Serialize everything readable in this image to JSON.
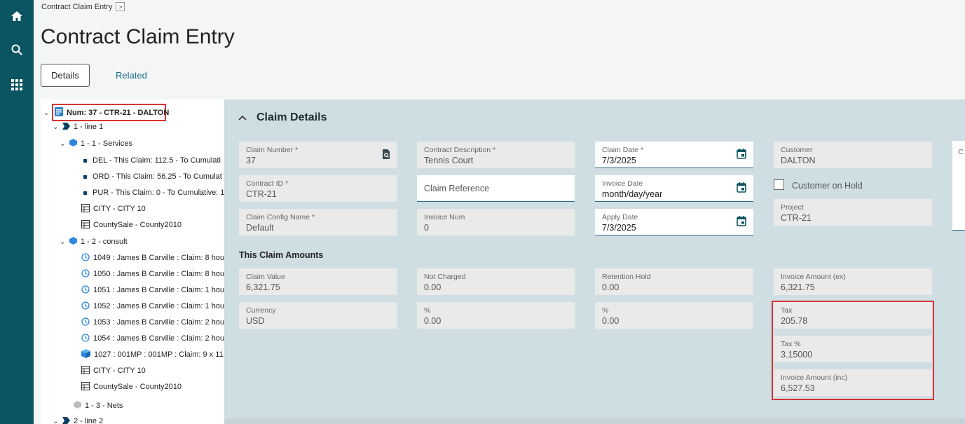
{
  "rail": {
    "icons": [
      "home-icon",
      "search-icon",
      "apps-grid-icon"
    ]
  },
  "breadcrumb": {
    "label": "Contract Claim Entry",
    "more": ">"
  },
  "page_title": "Contract Claim Entry",
  "tabs": [
    {
      "label": "Details"
    },
    {
      "label": "Related"
    }
  ],
  "tree": {
    "root": "Num: 37 - CTR-21 - DALTON",
    "nodes": [
      {
        "label": "1 - line 1"
      },
      {
        "label": "1 - 1 - Services"
      },
      {
        "label": "DEL - This Claim: 112.5 - To Cumulati"
      },
      {
        "label": "ORD - This Claim: 56.25 - To Cumulat"
      },
      {
        "label": "PUR - This Claim: 0 - To Cumulative: 1"
      },
      {
        "label": "CITY - CITY 10"
      },
      {
        "label": "CountySale - County2010"
      },
      {
        "label": "1 - 2 - consult"
      },
      {
        "label": "1049 : James B Carville : Claim: 8 hou"
      },
      {
        "label": "1050 : James B Carville : Claim: 8 hou"
      },
      {
        "label": "1051 : James B Carville : Claim: 1 hou"
      },
      {
        "label": "1052 : James B Carville : Claim: 1 hou"
      },
      {
        "label": "1053 : James B Carville : Claim: 2 hou"
      },
      {
        "label": "1054 : James B Carville : Claim: 2 hou"
      },
      {
        "label": "1027 : 001MP : 001MP : Claim: 9 x 11 U"
      },
      {
        "label": "CITY - CITY 10"
      },
      {
        "label": "CountySale - County2010"
      },
      {
        "label": "1 - 3 - Nets"
      },
      {
        "label": "2 - line 2"
      }
    ]
  },
  "claim_details": {
    "title": "Claim Details",
    "claim_number": {
      "label": "Claim Number *",
      "value": "37"
    },
    "contract_description": {
      "label": "Contract Description *",
      "value": "Tennis Court"
    },
    "claim_date": {
      "label": "Claim Date *",
      "value": "7/3/2025"
    },
    "customer": {
      "label": "Customer",
      "value": "DALTON"
    },
    "contract_id": {
      "label": "Contract ID *",
      "value": "CTR-21"
    },
    "claim_reference": {
      "label": "Claim Reference"
    },
    "invoice_date": {
      "label": "Invoice Date",
      "value": "month/day/year"
    },
    "customer_on_hold": {
      "label": "Customer on Hold",
      "checked": false
    },
    "project": {
      "label": "Project",
      "value": "CTR-21"
    },
    "claim_config_name": {
      "label": "Claim Config Name *",
      "value": "Default"
    },
    "invoice_num": {
      "label": "Invoice Num",
      "value": "0"
    },
    "apply_date": {
      "label": "Apply Date",
      "value": "7/3/2025"
    },
    "edge_label": "C"
  },
  "amounts": {
    "title": "This Claim Amounts",
    "claim_value": {
      "label": "Claim Value",
      "value": "6,321.75"
    },
    "not_charged": {
      "label": "Not Charged",
      "value": "0.00"
    },
    "retention_hold": {
      "label": "Retention Hold",
      "value": "0.00"
    },
    "invoice_amount_ex": {
      "label": "Invoice Amount (ex)",
      "value": "6,321.75"
    },
    "currency": {
      "label": "Currency",
      "value": "USD"
    },
    "not_charged_pct": {
      "label": "%",
      "value": "0.00"
    },
    "retention_pct": {
      "label": "%",
      "value": "0.00"
    },
    "tax": {
      "label": "Tax",
      "value": "205.78"
    },
    "tax_pct": {
      "label": "Tax %",
      "value": "3.15000"
    },
    "invoice_amount_inc": {
      "label": "Invoice Amount (inc)",
      "value": "6,527.53"
    }
  },
  "colors": {
    "rail": "#0b5563",
    "panel": "#cfdee3",
    "accent": "#1b6c8a",
    "highlight": "#d83434",
    "calendar": "#0b5563"
  }
}
